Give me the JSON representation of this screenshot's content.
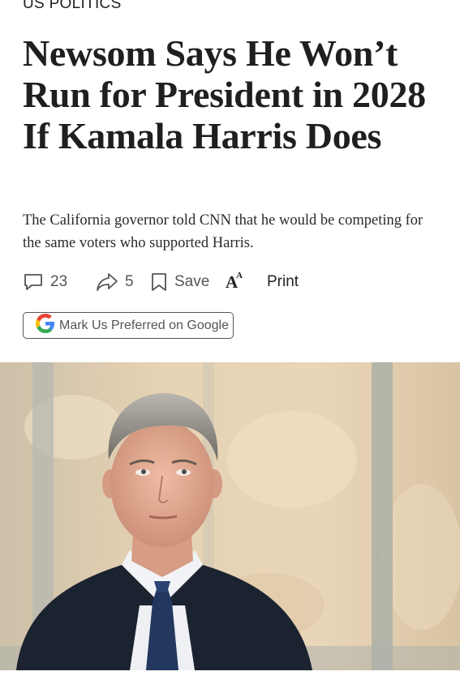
{
  "article": {
    "section": "US POLITICS",
    "headline": "Newsom Says He Won’t Run for President in 2028 If Kamala Harris Does",
    "dek": "The California governor told CNN that he would be competing for the same voters who supported Harris."
  },
  "actions": {
    "comments_count": "23",
    "shares_count": "5",
    "save_label": "Save",
    "text_size_label": "A",
    "print_label": "Print"
  },
  "google_preferred": {
    "label": "Mark Us Preferred on Google",
    "icon": "google-g-icon"
  },
  "icons": [
    "comment-icon",
    "share-icon",
    "bookmark-icon",
    "text-size-icon",
    "google-g-icon"
  ],
  "photo": {
    "subject": "portrait photograph of a man in a dark suit and blue tie"
  }
}
